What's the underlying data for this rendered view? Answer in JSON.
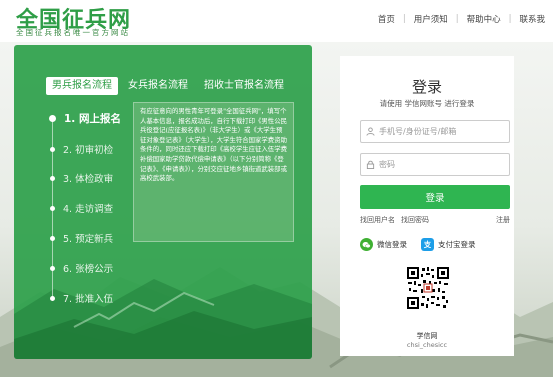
{
  "header": {
    "logo_title": "全国征兵网",
    "logo_subtitle": "全国征兵报名唯一官方网站",
    "nav": [
      "首页",
      "用户须知",
      "帮助中心",
      "联系我"
    ],
    "brand_color": "#2f9e47"
  },
  "process": {
    "tabs": [
      "男兵报名流程",
      "女兵报名流程",
      "招收士官报名流程"
    ],
    "active_tab": 0,
    "steps": [
      "1. 网上报名",
      "2. 初审初检",
      "3. 体检政审",
      "4. 走访调查",
      "5. 预定新兵",
      "6. 张榜公示",
      "7. 批准入伍"
    ],
    "active_step": 0,
    "description": "有应征意向的男性青年可登录\"全国征兵网\"，填写个人基本信息，报名成功后，自行下载打印《男性公民兵役登记(应征报名表)》（非大学生）或《大学生预征对象登记表》（大学生），大学生符合国家学费资助条件的，同时还应下载打印《高校学生应征入伍学费补偿国家助学贷款代偿申请表》（以下分别简称《登记表》、《申请表》），分别交应征地乡镇街道武装部或高校武装部。"
  },
  "login": {
    "title": "登录",
    "hint": "请使用  学信网账号  进行登录",
    "username_placeholder": "手机号/身份证号/邮箱",
    "password_placeholder": "密码",
    "login_button": "登录",
    "find_username": "找回用户名",
    "find_password": "找回密码",
    "register": "注册",
    "wechat_login": "微信登录",
    "alipay_login": "支付宝登录",
    "wechat_color": "#3fb033",
    "alipay_color": "#1d9ee8",
    "qr_label": "学信网",
    "qr_account": "chsi_chesicc"
  }
}
